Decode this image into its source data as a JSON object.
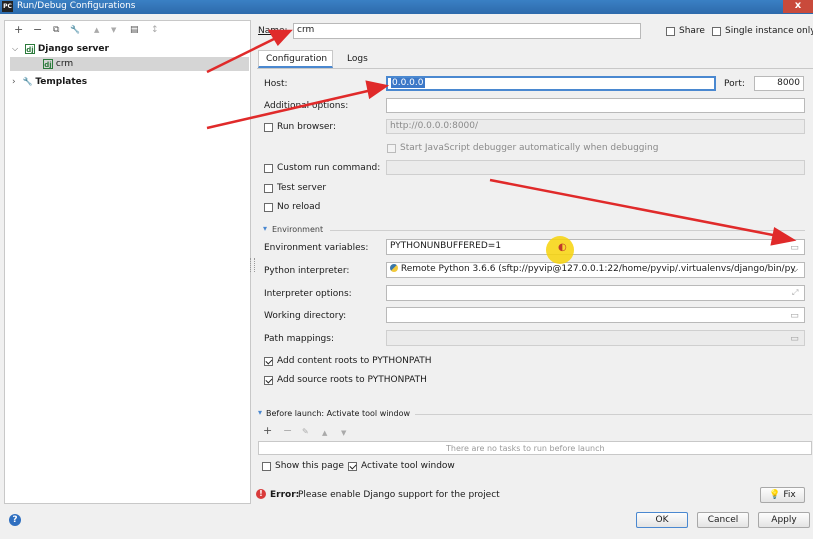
{
  "window": {
    "title": "Run/Debug Configurations",
    "app_icon": "PC",
    "close": "x"
  },
  "left": {
    "toolbar": [
      "+",
      "−",
      "⧉",
      "🔧",
      "▲",
      "▼",
      "▤",
      "↕"
    ],
    "tree": {
      "group_label": "Django server",
      "item_label": "crm",
      "templates_label": "Templates"
    }
  },
  "name_field": {
    "label": "Name:",
    "value": "crm"
  },
  "share": {
    "label": "Share",
    "checked": false
  },
  "single_instance": {
    "label": "Single instance only",
    "checked": false
  },
  "tabs": [
    "Configuration",
    "Logs"
  ],
  "host": {
    "label": "Host:",
    "value": "0.0.0.0"
  },
  "port": {
    "label": "Port:",
    "value": "8000"
  },
  "additional_options": {
    "label": "Additional options:",
    "value": ""
  },
  "run_browser": {
    "label": "Run browser:",
    "checked": false,
    "value": "http://0.0.0.0:8000/"
  },
  "js_debugger": {
    "label": "Start JavaScript debugger automatically when debugging",
    "checked": false
  },
  "custom_run_command": {
    "label": "Custom run command:",
    "checked": false,
    "value": ""
  },
  "test_server": {
    "label": "Test server",
    "checked": false
  },
  "no_reload": {
    "label": "No reload",
    "checked": false
  },
  "environment": {
    "section_label": "Environment"
  },
  "env_vars": {
    "label": "Environment variables:",
    "value": "PYTHONUNBUFFERED=1"
  },
  "python_interpreter": {
    "label": "Python interpreter:",
    "value": "Remote Python 3.6.6 (sftp://pyvip@127.0.0.1:22/home/pyvip/.virtualenvs/django/bin/py"
  },
  "interpreter_options": {
    "label": "Interpreter options:",
    "value": ""
  },
  "working_directory": {
    "label": "Working directory:",
    "value": ""
  },
  "path_mappings": {
    "label": "Path mappings:",
    "value": ""
  },
  "add_content_roots": {
    "label": "Add content roots to PYTHONPATH",
    "checked": true
  },
  "add_source_roots": {
    "label": "Add source roots to PYTHONPATH",
    "checked": true
  },
  "before_launch": {
    "label": "Before launch: Activate tool window",
    "toolbar": [
      "+",
      "−",
      "✎",
      "▲",
      "▼"
    ],
    "empty_text": "There are no tasks to run before launch"
  },
  "show_this_page": {
    "label": "Show this page",
    "checked": false
  },
  "activate_tool_window": {
    "label": "Activate tool window",
    "checked": true
  },
  "error": {
    "prefix": "Error:",
    "message": "Please enable Django support for the project"
  },
  "buttons": {
    "fix": "Fix",
    "ok": "OK",
    "cancel": "Cancel",
    "apply": "Apply",
    "help": "?"
  },
  "colors": {
    "annotation_arrow": "#e02a2a",
    "highlight": "#f7d40b",
    "selection": "#3c78c8"
  }
}
